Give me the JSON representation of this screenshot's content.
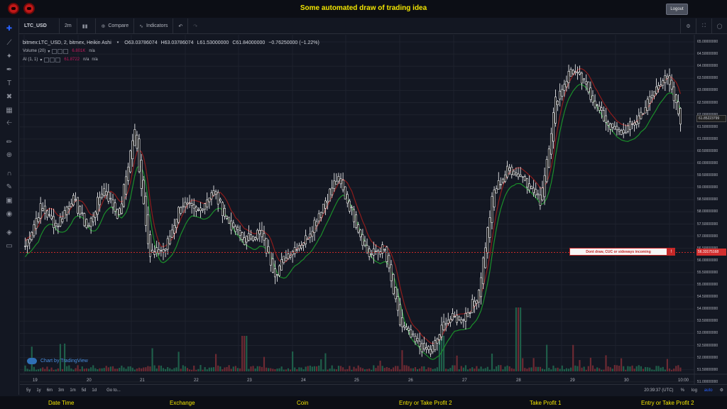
{
  "header": {
    "title": "Some automated draw of trading idea",
    "logout_label": "Logout"
  },
  "toolbar": {
    "symbol": "LTC_USD",
    "interval": "2m",
    "compare_label": "Compare",
    "indicators_label": "Indicators"
  },
  "legend": {
    "title": "bitmex:LTC_USD, 2, bitmex, Heikin Ashi",
    "open": "O63.03786074",
    "high": "H63.03786074",
    "low": "L61.53000000",
    "close": "C61.84000000",
    "change": "−0.76250000 (−1.22%)",
    "volume_label": "Volume (20)",
    "volume_value": "6.801K",
    "volume_na": "n/a",
    "ai_label": "AI (1, 1)",
    "ai_value1": "61.8722",
    "ai_na1": "n/a",
    "ai_na2": "n/a"
  },
  "branding": "Chart by TradingView",
  "annotation": {
    "text": "Dont draw, CUC or sideways incoming",
    "flag": "!"
  },
  "price_axis": [
    "65.00000000",
    "64.50000000",
    "64.00000000",
    "63.50000000",
    "63.00000000",
    "62.50000000",
    "62.00000000",
    "61.50000000",
    "61.00000000",
    "60.50000000",
    "60.00000000",
    "59.50000000",
    "59.00000000",
    "58.50000000",
    "58.00000000",
    "57.50000000",
    "57.00000000",
    "56.50000000",
    "56.00000000",
    "55.50000000",
    "55.00000000",
    "54.50000000",
    "54.00000000",
    "53.50000000",
    "53.00000000",
    "52.50000000",
    "52.00000000",
    "51.50000000",
    "51.00000000"
  ],
  "last_price": "61.85223799",
  "line_price": "56.33175168",
  "time_axis": [
    "19",
    "20",
    "21",
    "22",
    "23",
    "24",
    "25",
    "26",
    "27",
    "28",
    "29",
    "30",
    "10:00"
  ],
  "range_bar": {
    "buttons": [
      "5y",
      "1y",
      "6m",
      "3m",
      "1m",
      "5d",
      "1d"
    ],
    "goto": "Go to...",
    "clock": "20:39:37 (UTC)",
    "percent": "%",
    "log": "log",
    "auto": "auto"
  },
  "footer": {
    "col1": "Date Time",
    "col2": "Exchange",
    "col3": "Coin",
    "col4": "Entry or Take Profit 2",
    "col5": "Take Profit 1",
    "col6": "Entry or Take Profit 2"
  },
  "chart_data": {
    "type": "candlestick",
    "title": "bitmex:LTC_USD, 2, bitmex, Heikin Ashi",
    "ylim": [
      51.0,
      65.0
    ],
    "x": [
      "19",
      "20",
      "21",
      "22",
      "23",
      "24",
      "25",
      "26",
      "27",
      "28",
      "29",
      "30",
      "10:00"
    ],
    "close_path": [
      56.6,
      58.2,
      57.4,
      58.6,
      57.3,
      59.0,
      57.8,
      61.4,
      56.2,
      56.5,
      58.4,
      57.9,
      58.9,
      57.6,
      56.8,
      57.2,
      55.5,
      56.4,
      56.9,
      58.2,
      59.4,
      57.9,
      56.2,
      56.5,
      53.4,
      52.6,
      52.2,
      53.6,
      53.6,
      54.5,
      58.8,
      59.8,
      59.4,
      58.4,
      62.6,
      63.9,
      63.1,
      61.9,
      61.2,
      61.6,
      62.6,
      63.7,
      61.8
    ],
    "series": [
      {
        "name": "",
        "color": "#26a69a"
      },
      {
        "name": "",
        "color": "#c62828"
      }
    ],
    "horizontal_line": 56.33175168
  },
  "colors": {
    "background": "#131722",
    "grid": "#1e222d",
    "candle_body": "#000000",
    "candle_border": "#ffffff",
    "ma_green": "#1b8f2b",
    "ma_red": "#8e1c1c",
    "volume_up": "#1f5f4a",
    "volume_down": "#6e2a33",
    "title_yellow": "#f3e600"
  }
}
